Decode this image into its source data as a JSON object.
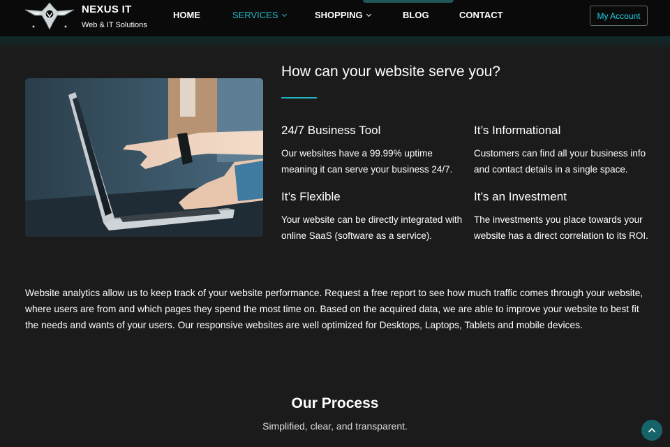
{
  "brand": {
    "name": "NEXUS IT",
    "tagline": "Web & IT Solutions",
    "logo_icon": "winged-shield-logo-icon"
  },
  "nav": {
    "items": [
      {
        "label": "HOME",
        "has_dropdown": false,
        "active": false
      },
      {
        "label": "SERVICES",
        "has_dropdown": true,
        "active": true
      },
      {
        "label": "SHOPPING",
        "has_dropdown": true,
        "active": false
      },
      {
        "label": "BLOG",
        "has_dropdown": false,
        "active": false
      },
      {
        "label": "CONTACT",
        "has_dropdown": false,
        "active": false
      }
    ],
    "account_label": "My Account"
  },
  "section": {
    "title": "How can your website serve you?",
    "image_icon": "laptop-photo",
    "features": [
      {
        "heading": "24/7 Business Tool",
        "text": "Our websites have a 99.99% uptime meaning it can serve your business 24/7."
      },
      {
        "heading": "It’s Informational",
        "text": "Customers can find all your business info and contact details in a single space."
      },
      {
        "heading": "It’s Flexible",
        "text": "Your website can be directly integrated with online SaaS (software as a service)."
      },
      {
        "heading": "It’s an Investment",
        "text": "The investments you place towards your website has a direct correlation to its ROI."
      }
    ],
    "paragraph": "Website analytics allow us to keep track of your website performance. Request a free report to see how much traffic comes through your website, where users are from and which pages they spend the most time on. Based on the acquired data, we are able to improve your website to best fit the needs and wants of your users. Our responsive websites are well optimized for Desktops, Laptops, Tablets and mobile devices."
  },
  "process": {
    "title": "Our Process",
    "subtitle": "Simplified, clear, and transparent."
  },
  "scroll_top_icon": "chevron-up-icon",
  "colors": {
    "background": "#1b1b1b",
    "header": "#0a0a0a",
    "accent": "#1fb6c4",
    "scroll_button": "#16636a"
  }
}
